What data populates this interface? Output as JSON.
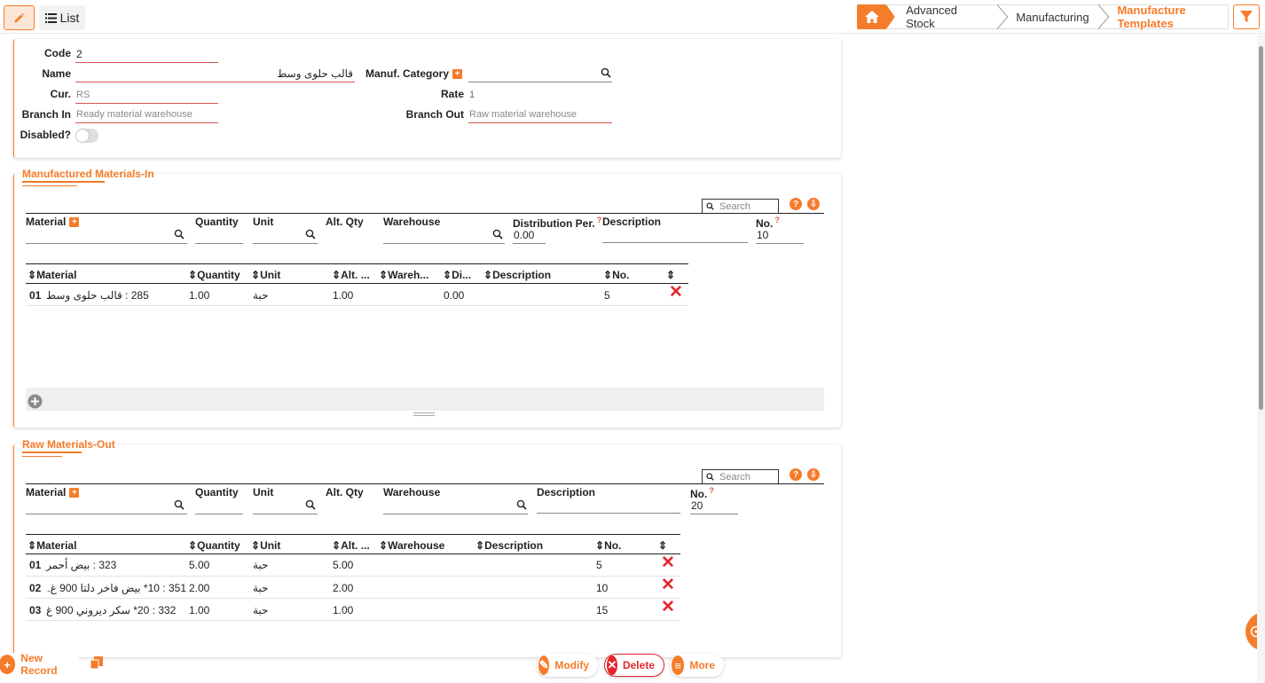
{
  "toolbar": {
    "list_label": "List"
  },
  "breadcrumb": {
    "items": [
      "Advanced Stock",
      "Manufacturing",
      "Manufacture Templates"
    ]
  },
  "form": {
    "code_label": "Code",
    "code_value": "2",
    "name_label": "Name",
    "name_value": "قالب حلوى وسط",
    "manuf_category_label": "Manuf. Category",
    "manuf_category_value": "",
    "cur_label": "Cur.",
    "cur_value": "RS",
    "rate_label": "Rate",
    "rate_value": "1",
    "branch_in_label": "Branch In",
    "branch_in_value": "Ready material warehouse",
    "branch_out_label": "Branch Out",
    "branch_out_value": "Raw material warehouse",
    "disabled_label": "Disabled?"
  },
  "materials_in": {
    "title": "Manufactured Materials-In",
    "search_placeholder": "Search",
    "entry": {
      "material_label": "Material",
      "quantity_label": "Quantity",
      "unit_label": "Unit",
      "alt_qty_label": "Alt. Qty",
      "warehouse_label": "Warehouse",
      "distribution_label": "Distribution Per.",
      "distribution_value": "0.00",
      "description_label": "Description",
      "no_label": "No.",
      "no_value": "10"
    },
    "columns": [
      "Material",
      "Quantity",
      "Unit",
      "Alt. ...",
      "Wareh...",
      "Di...",
      "Description",
      "No.",
      ""
    ],
    "rows": [
      {
        "idx": "01",
        "material": "285 : قالب حلوى وسط",
        "quantity": "1.00",
        "unit": "حبة",
        "alt": "1.00",
        "warehouse": "",
        "dist": "0.00",
        "description": "",
        "no": "5"
      }
    ]
  },
  "materials_out": {
    "title": "Raw Materials-Out",
    "search_placeholder": "Search",
    "entry": {
      "material_label": "Material",
      "quantity_label": "Quantity",
      "unit_label": "Unit",
      "alt_qty_label": "Alt. Qty",
      "warehouse_label": "Warehouse",
      "description_label": "Description",
      "no_label": "No.",
      "no_value": "20"
    },
    "columns": [
      "Material",
      "Quantity",
      "Unit",
      "Alt. ...",
      "Warehouse",
      "Description",
      "No.",
      ""
    ],
    "rows": [
      {
        "idx": "01",
        "material": "323 : بيض أحمر",
        "quantity": "5.00",
        "unit": "حبة",
        "alt": "5.00",
        "warehouse": "",
        "description": "",
        "no": "5"
      },
      {
        "idx": "02",
        "material": "351 : 10* بيض فاخر دلتا 900 غ...",
        "quantity": "2.00",
        "unit": "حبة",
        "alt": "2.00",
        "warehouse": "",
        "description": "",
        "no": "10"
      },
      {
        "idx": "03",
        "material": "332 : 20* سكر ديروني 900 غ",
        "quantity": "1.00",
        "unit": "حبة",
        "alt": "1.00",
        "warehouse": "",
        "description": "",
        "no": "15"
      }
    ]
  },
  "footer": {
    "new_record": "New Record",
    "modify": "Modify",
    "delete": "Delete",
    "more": "More"
  },
  "colors": {
    "accent": "#f57c2a",
    "danger": "#e3262b"
  }
}
